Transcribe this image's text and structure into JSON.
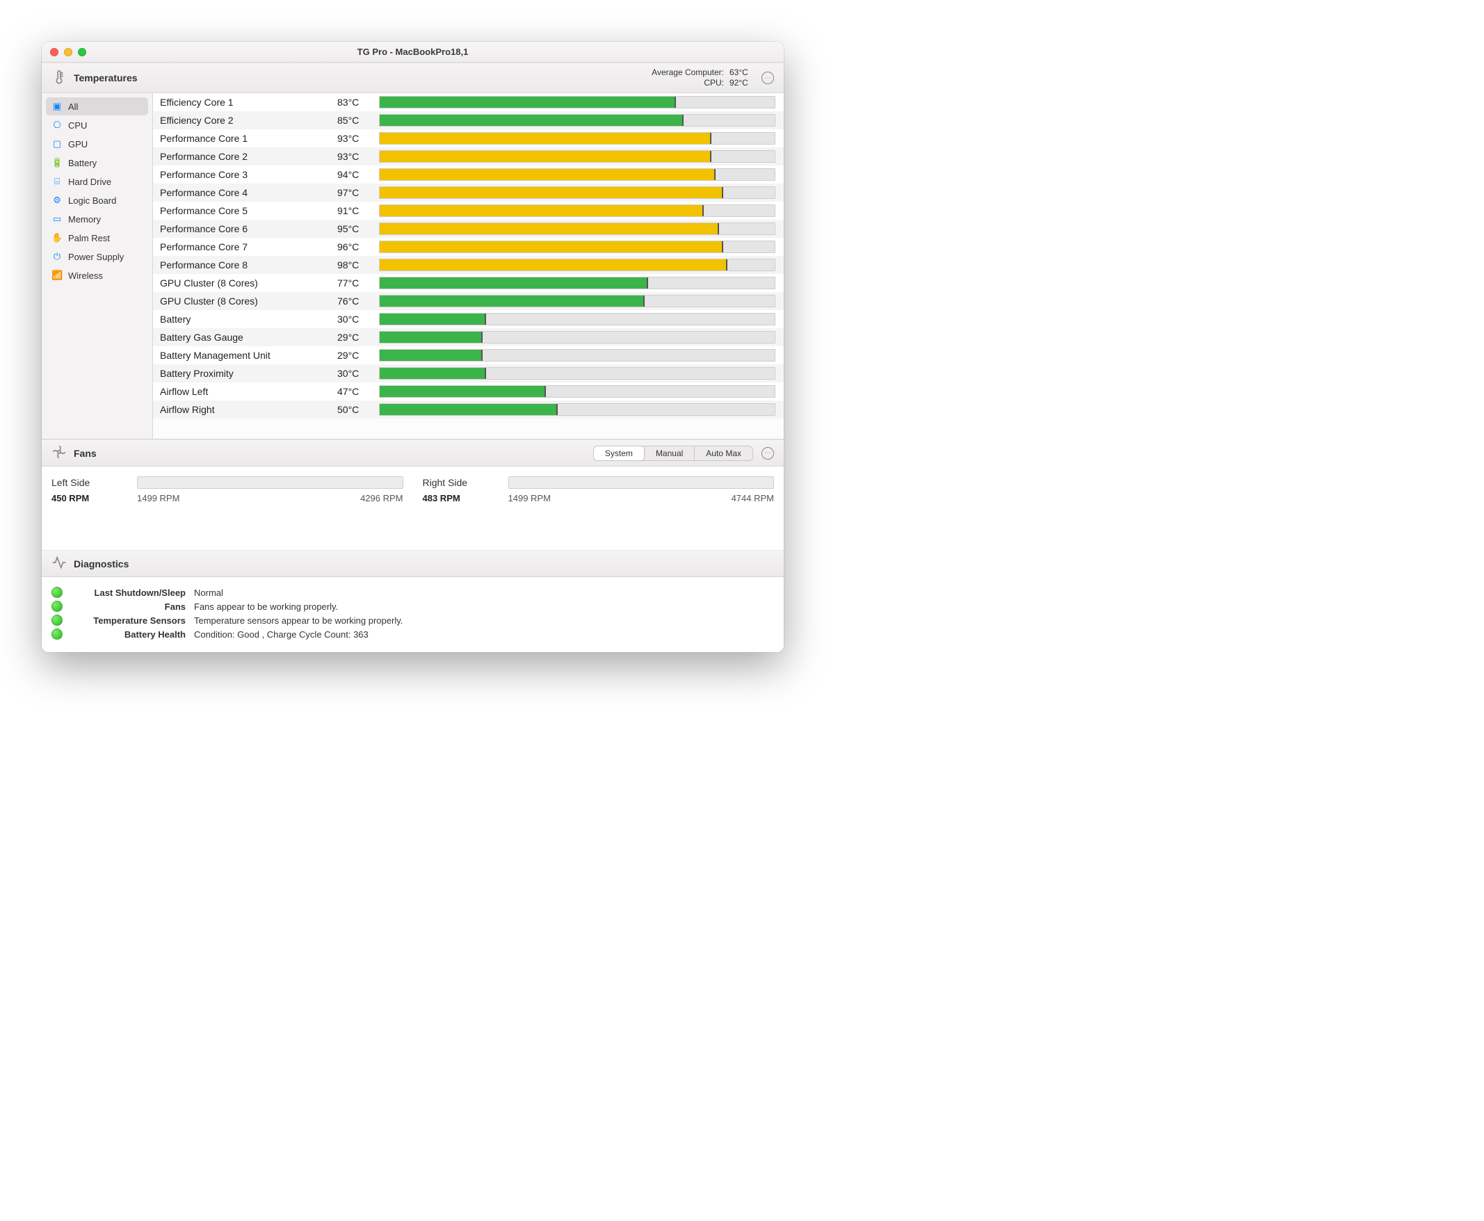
{
  "window": {
    "title": "TG Pro - MacBookPro18,1"
  },
  "temps_header": {
    "title": "Temperatures",
    "avg_computer_label": "Average Computer:",
    "avg_computer_value": "63°C",
    "avg_cpu_label": "CPU:",
    "avg_cpu_value": "92°C"
  },
  "sidebar": {
    "items": [
      {
        "icon": "square-dashed-icon",
        "glyph": "▣",
        "label": "All",
        "selected": true
      },
      {
        "icon": "cpu-icon",
        "glyph": "⎔",
        "label": "CPU",
        "selected": false
      },
      {
        "icon": "gpu-icon",
        "glyph": "▢",
        "label": "GPU",
        "selected": false
      },
      {
        "icon": "battery-icon",
        "glyph": "🔋",
        "label": "Battery",
        "selected": false
      },
      {
        "icon": "hard-drive-icon",
        "glyph": "⌸",
        "label": "Hard Drive",
        "selected": false
      },
      {
        "icon": "logic-board-icon",
        "glyph": "⚙",
        "label": "Logic Board",
        "selected": false
      },
      {
        "icon": "memory-icon",
        "glyph": "▭",
        "label": "Memory",
        "selected": false
      },
      {
        "icon": "palm-rest-icon",
        "glyph": "✋",
        "label": "Palm Rest",
        "selected": false
      },
      {
        "icon": "power-supply-icon",
        "glyph": "⏻",
        "label": "Power Supply",
        "selected": false
      },
      {
        "icon": "wireless-icon",
        "glyph": "📶",
        "label": "Wireless",
        "selected": false
      }
    ]
  },
  "temp_rows": [
    {
      "name": "Efficiency Core 1",
      "value": "83°C",
      "pct": 75,
      "color": "green"
    },
    {
      "name": "Efficiency Core 2",
      "value": "85°C",
      "pct": 77,
      "color": "green"
    },
    {
      "name": "Performance Core 1",
      "value": "93°C",
      "pct": 84,
      "color": "yellow"
    },
    {
      "name": "Performance Core 2",
      "value": "93°C",
      "pct": 84,
      "color": "yellow"
    },
    {
      "name": "Performance Core 3",
      "value": "94°C",
      "pct": 85,
      "color": "yellow"
    },
    {
      "name": "Performance Core 4",
      "value": "97°C",
      "pct": 87,
      "color": "yellow"
    },
    {
      "name": "Performance Core 5",
      "value": "91°C",
      "pct": 82,
      "color": "yellow"
    },
    {
      "name": "Performance Core 6",
      "value": "95°C",
      "pct": 86,
      "color": "yellow"
    },
    {
      "name": "Performance Core 7",
      "value": "96°C",
      "pct": 87,
      "color": "yellow"
    },
    {
      "name": "Performance Core 8",
      "value": "98°C",
      "pct": 88,
      "color": "yellow"
    },
    {
      "name": "GPU Cluster (8 Cores)",
      "value": "77°C",
      "pct": 68,
      "color": "green"
    },
    {
      "name": "GPU Cluster (8 Cores)",
      "value": "76°C",
      "pct": 67,
      "color": "green"
    },
    {
      "name": "Battery",
      "value": "30°C",
      "pct": 27,
      "color": "green"
    },
    {
      "name": "Battery Gas Gauge",
      "value": "29°C",
      "pct": 26,
      "color": "green"
    },
    {
      "name": "Battery Management Unit",
      "value": "29°C",
      "pct": 26,
      "color": "green"
    },
    {
      "name": "Battery Proximity",
      "value": "30°C",
      "pct": 27,
      "color": "green"
    },
    {
      "name": "Airflow Left",
      "value": "47°C",
      "pct": 42,
      "color": "green"
    },
    {
      "name": "Airflow Right",
      "value": "50°C",
      "pct": 45,
      "color": "green"
    }
  ],
  "fans_header": {
    "title": "Fans",
    "modes": [
      {
        "label": "System",
        "active": true
      },
      {
        "label": "Manual",
        "active": false
      },
      {
        "label": "Auto Max",
        "active": false
      }
    ]
  },
  "fans": [
    {
      "name": "Left Side",
      "current": "450 RPM",
      "min": "1499 RPM",
      "max": "4296 RPM"
    },
    {
      "name": "Right Side",
      "current": "483 RPM",
      "min": "1499 RPM",
      "max": "4744 RPM"
    }
  ],
  "diags_header": {
    "title": "Diagnostics"
  },
  "diags": [
    {
      "label": "Last Shutdown/Sleep",
      "value": "Normal"
    },
    {
      "label": "Fans",
      "value": "Fans appear to be working properly."
    },
    {
      "label": "Temperature Sensors",
      "value": "Temperature sensors appear to be working properly."
    },
    {
      "label": "Battery Health",
      "value": "Condition: Good , Charge Cycle Count: 363"
    }
  ]
}
